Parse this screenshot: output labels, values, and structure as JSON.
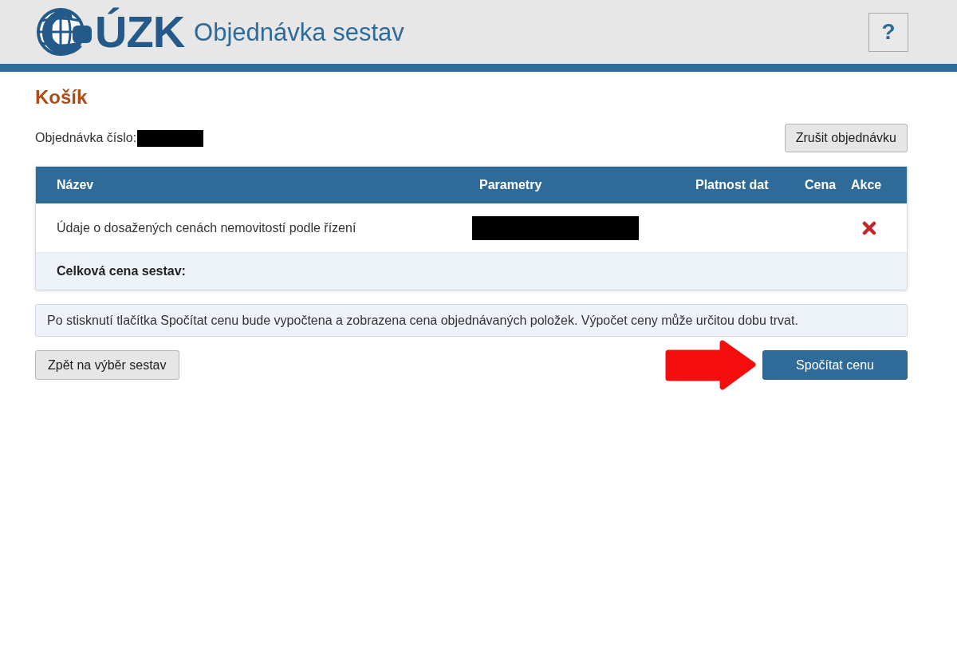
{
  "header": {
    "logo_text": "ÚZK",
    "title": "Objednávka sestav",
    "help_button": "?"
  },
  "page_title": "Košík",
  "order": {
    "label": "Objednávka číslo:",
    "number_redacted": true
  },
  "cancel_button": "Zrušit objednávku",
  "table": {
    "columns": [
      "Název",
      "Parametry",
      "Platnost dat",
      "Cena",
      "Akce"
    ],
    "rows": [
      {
        "name": "Údaje o dosažených cenách nemovitostí podle řízení",
        "parameters_redacted": true,
        "removable": true
      }
    ],
    "total_label": "Celková cena sestav:"
  },
  "info_message": "Po stisknutí tlačítka Spočítat cenu bude vypočtena a zobrazena cena objednávaných položek. Výpočet ceny může určitou dobu trvat.",
  "buttons": [
    {
      "label": "Zpět na výběr sestav",
      "kind": "secondary"
    },
    {
      "label": "Spočítat cenu",
      "kind": "primary"
    }
  ]
}
